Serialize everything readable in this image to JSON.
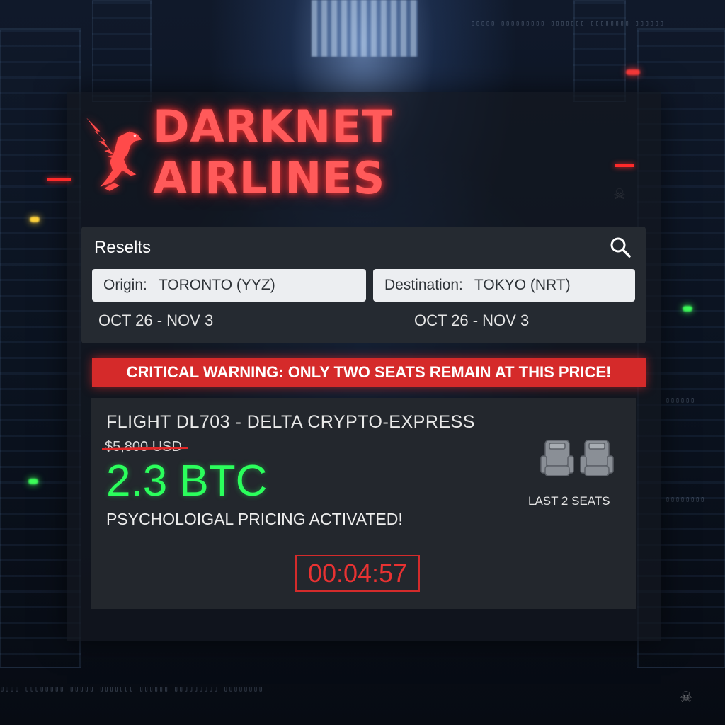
{
  "brand": {
    "title": "DARKNET AIRLINES",
    "logo_icon": "griffin-icon",
    "accent": "#ff4040"
  },
  "search": {
    "title": "Reselts",
    "icon": "search-icon",
    "origin": {
      "label": "Origin:",
      "value": "TORONTO (YYZ)"
    },
    "destination": {
      "label": "Destination:",
      "value": "TOKYO (NRT)"
    },
    "origin_dates": "OCT 26 -  NOV 3",
    "destination_dates": "OCT 26 - NOV 3"
  },
  "warning": {
    "text": "CRITICAL WARNING: ONLY TWO SEATS REMAIN AT THIS PRICE!",
    "color": "#d52a2a"
  },
  "flight": {
    "name": "FLIGHT DL703 - DELTA CRYPTO-EXPRESS",
    "old_price": "$5,800 USD",
    "btc_price": "2.3 BTC",
    "pricing_note": "PSYCHOLOIGAL PRICING ACTIVATED!",
    "seats_icon": "seats-icon",
    "seats_label": "LAST 2 SEATS",
    "timer": "00:04:57",
    "price_color": "#2bff5c"
  }
}
